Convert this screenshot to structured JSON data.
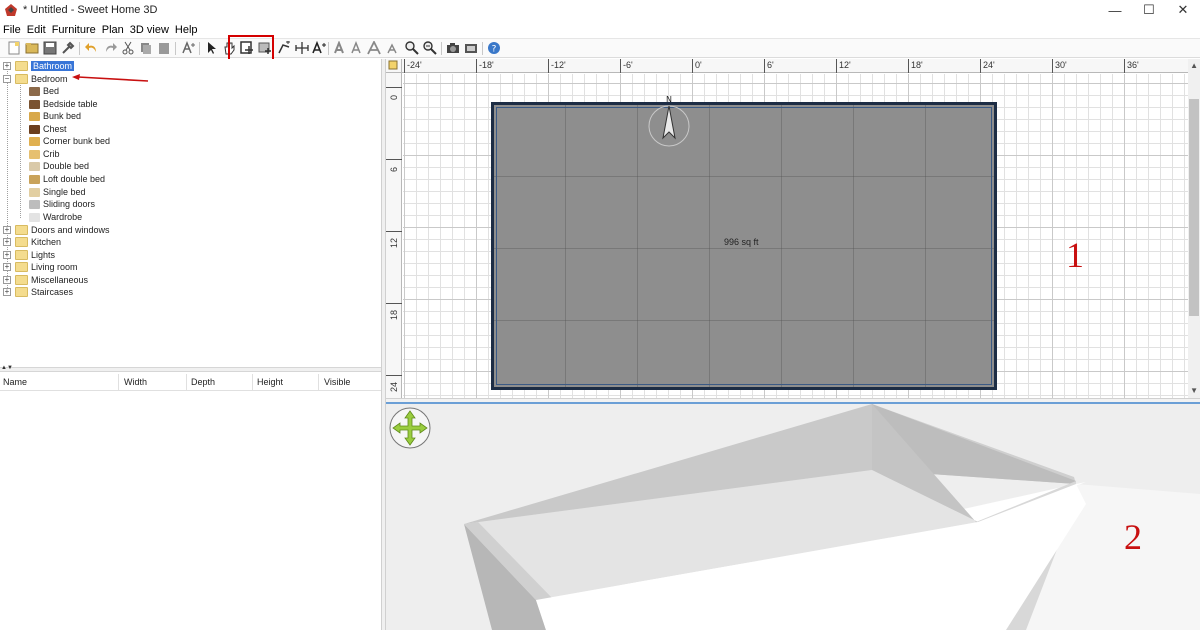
{
  "window": {
    "title": "* Untitled - Sweet Home 3D",
    "controls": [
      "—",
      "☐",
      "✕"
    ]
  },
  "menu": [
    "File",
    "Edit",
    "Furniture",
    "Plan",
    "3D view",
    "Help"
  ],
  "catalog": {
    "categories": [
      {
        "label": "Bathroom",
        "selected": true,
        "expanded": false
      },
      {
        "label": "Bedroom",
        "selected": false,
        "expanded": true,
        "items": [
          "Bed",
          "Bedside table",
          "Bunk bed",
          "Chest",
          "Corner bunk bed",
          "Crib",
          "Double bed",
          "Loft double bed",
          "Single bed",
          "Sliding doors",
          "Wardrobe"
        ]
      },
      {
        "label": "Doors and windows",
        "expanded": false
      },
      {
        "label": "Kitchen",
        "expanded": false
      },
      {
        "label": "Lights",
        "expanded": false
      },
      {
        "label": "Living room",
        "expanded": false
      },
      {
        "label": "Miscellaneous",
        "expanded": false
      },
      {
        "label": "Staircases",
        "expanded": false
      }
    ]
  },
  "furniture_table": {
    "columns": [
      "Name",
      "Width",
      "Depth",
      "Height",
      "Visible"
    ]
  },
  "plan": {
    "ruler_top": [
      "-24'",
      "-18'",
      "-12'",
      "-6'",
      "0'",
      "6'",
      "12'",
      "18'",
      "24'",
      "30'",
      "36'"
    ],
    "ruler_left": [
      "0",
      "6",
      "12",
      "18",
      "24"
    ],
    "room_area": "996 sq ft",
    "compass_label": "N"
  },
  "annotations": {
    "plan_marker": "1",
    "view3d_marker": "2"
  },
  "colors": {
    "accent_selection": "#3875d7",
    "highlight_red": "#d40000",
    "room_fill": "#8e8e8e",
    "wall_outline": "#1d2d45"
  }
}
